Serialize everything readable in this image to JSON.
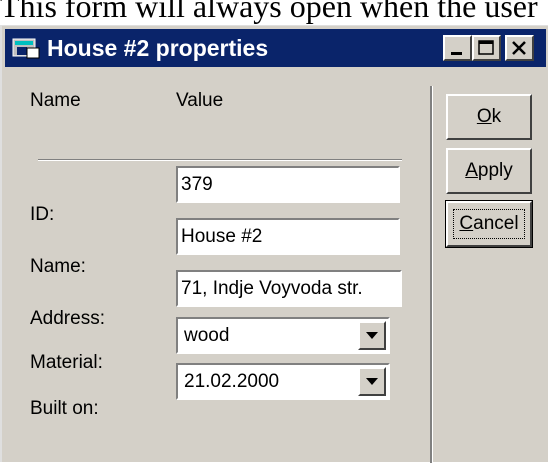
{
  "caption": "This form will always open when the user",
  "window": {
    "title": "House #2 properties"
  },
  "header": {
    "name_col": "Name",
    "value_col": "Value"
  },
  "fields": [
    {
      "label": "ID:",
      "value": "379"
    },
    {
      "label": "Name:",
      "value": "House #2"
    },
    {
      "label": "Address:",
      "value": "71, Indje Voyvoda str."
    },
    {
      "label": "Material:",
      "value": "wood"
    },
    {
      "label": "Built on:",
      "value": "21.02.2000"
    }
  ],
  "buttons": {
    "ok": {
      "mnemonic": "O",
      "rest": "k"
    },
    "apply": {
      "mnemonic": "A",
      "rest": "pply"
    },
    "cancel": {
      "mnemonic": "C",
      "rest": "ancel"
    }
  }
}
